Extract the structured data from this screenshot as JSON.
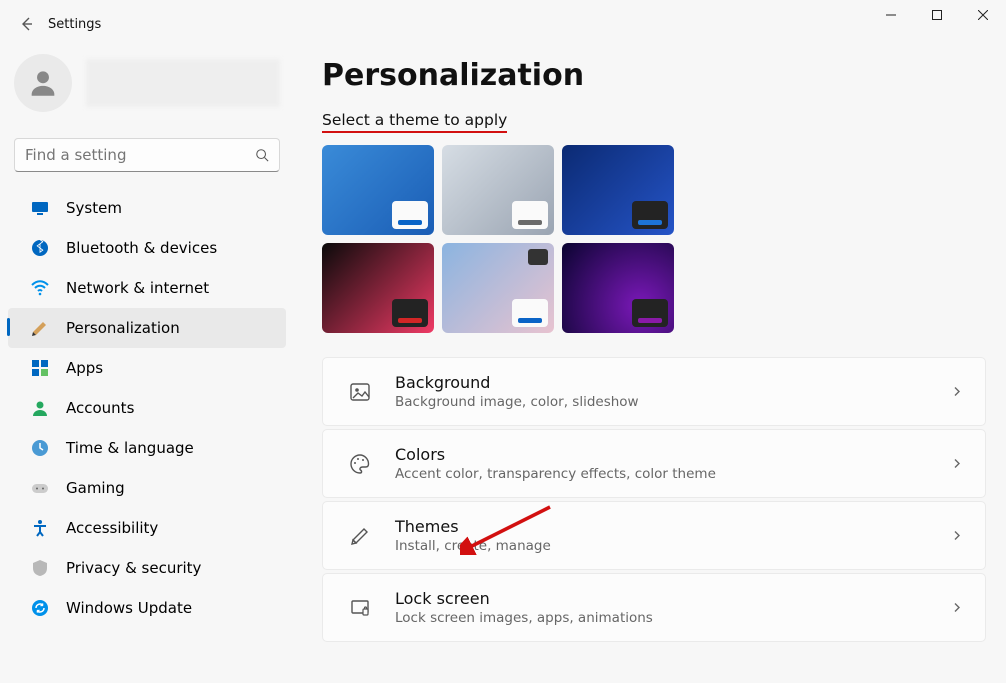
{
  "window": {
    "title": "Settings"
  },
  "search": {
    "placeholder": "Find a setting"
  },
  "nav": [
    {
      "id": "system",
      "label": "System"
    },
    {
      "id": "bluetooth",
      "label": "Bluetooth & devices"
    },
    {
      "id": "network",
      "label": "Network & internet"
    },
    {
      "id": "personalization",
      "label": "Personalization",
      "active": true
    },
    {
      "id": "apps",
      "label": "Apps"
    },
    {
      "id": "accounts",
      "label": "Accounts"
    },
    {
      "id": "time",
      "label": "Time & language"
    },
    {
      "id": "gaming",
      "label": "Gaming"
    },
    {
      "id": "accessibility",
      "label": "Accessibility"
    },
    {
      "id": "privacy",
      "label": "Privacy & security"
    },
    {
      "id": "update",
      "label": "Windows Update"
    }
  ],
  "page": {
    "heading": "Personalization",
    "subheading": "Select a theme to apply"
  },
  "themes": [
    {
      "bg": "linear-gradient(135deg,#3a8bd8,#1a5db5)",
      "corner_bg": "#fafafa",
      "bar": "#0a64c7"
    },
    {
      "bg": "linear-gradient(135deg,#d6dde4,#9aa4b2)",
      "corner_bg": "#fafafa",
      "bar": "#6a6a6a"
    },
    {
      "bg": "linear-gradient(135deg,#0b2a73,#2554c7)",
      "corner_bg": "#232323",
      "bar": "#1d74d8"
    },
    {
      "bg": "linear-gradient(135deg,#0a0a0a,#ef3a65)",
      "corner_bg": "#232323",
      "bar": "#d32626"
    },
    {
      "bg": "linear-gradient(135deg,#8bb4e0,#e8c3d0)",
      "corner_bg": "#fafafa",
      "bar": "#0a64c7",
      "camera": true
    },
    {
      "bg": "radial-gradient(circle at 70% 70%,#7a18b8,#0a0430)",
      "corner_bg": "#232323",
      "bar": "#8a1aa8"
    }
  ],
  "cards": [
    {
      "id": "background",
      "title": "Background",
      "desc": "Background image, color, slideshow"
    },
    {
      "id": "colors",
      "title": "Colors",
      "desc": "Accent color, transparency effects, color theme"
    },
    {
      "id": "themes",
      "title": "Themes",
      "desc": "Install, create, manage"
    },
    {
      "id": "lockscreen",
      "title": "Lock screen",
      "desc": "Lock screen images, apps, animations"
    }
  ]
}
